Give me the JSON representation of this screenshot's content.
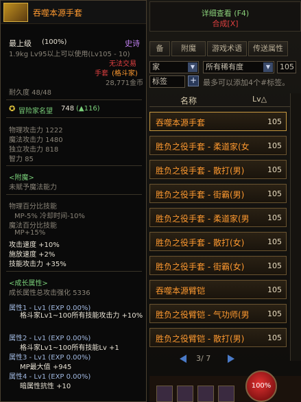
{
  "top_panel": {
    "detail": "详细查看 (F4)",
    "compose": "合成[X]"
  },
  "tabs": [
    "备",
    "附魔",
    "游戏术语",
    "传送属性"
  ],
  "filters": {
    "select1": "家",
    "rarity": "所有稀有度",
    "level": "105",
    "tag_select": "标签",
    "tag_hint": "最多可以添加4个#标签。"
  },
  "list": {
    "header_name": "名称",
    "header_lv": "Lv△",
    "rows": [
      {
        "name": "吞噬本源手套",
        "level": "105"
      },
      {
        "name": "胜负之役手套 - 柔道家(女",
        "level": "105"
      },
      {
        "name": "胜负之役手套 - 散打(男)",
        "level": "105"
      },
      {
        "name": "胜负之役手套 - 街霸(男)",
        "level": "105"
      },
      {
        "name": "胜负之役手套 - 柔道家(男",
        "level": "105"
      },
      {
        "name": "胜负之役手套 - 散打(女)",
        "level": "105"
      },
      {
        "name": "胜负之役手套 - 街霸(女)",
        "level": "105"
      },
      {
        "name": "吞噬本源臂铠",
        "level": "105"
      },
      {
        "name": "胜负之役臂铠 - 气功师(男",
        "level": "105"
      },
      {
        "name": "胜负之役臂铠 - 散打(男)",
        "level": "105"
      }
    ]
  },
  "pager": {
    "page": "3/ 7"
  },
  "orb": {
    "value": "100%"
  },
  "tooltip": {
    "name": "吞噬本源手套",
    "top_level": "最上级",
    "percent": "(100%)",
    "rarity": "史诗",
    "weight_req": "1.9kg  Lv95以上可以使用(Lv105 - 10)",
    "no_trade": "无法交易",
    "type": "手套",
    "class": "(格斗家)",
    "price": "28,771金币",
    "durability": "耐久度 48/48",
    "fame_label": "冒险家名望",
    "fame_value": "748",
    "fame_delta": "(▲116)",
    "stats": [
      "物理攻击力 1222",
      "魔法攻击力 1480",
      "独立攻击力 818",
      "智力 85"
    ],
    "enchant_header": "<附魔>",
    "enchant_value": "未赋予魔法能力",
    "pct_header": "物理百分比技能",
    "pct_line1": "MP-5% 冷却时间-10%",
    "pct_header2": "魔法百分比技能",
    "pct_line2": "MP+15%",
    "speed_lines": [
      "攻击速度 +10%",
      "施放速度 +2%",
      "技能攻击力 +35%"
    ],
    "growth_header": "<成长属性>",
    "growth_total": "成长属性总攻击强化 5336",
    "attributes": [
      {
        "title": "属性1 - Lv1 (EXP 0.00%)",
        "detail": "格斗家Lv1~100所有技能攻击力 +10%"
      },
      {
        "title": "属性2 - Lv1 (EXP 0.00%)",
        "detail": "格斗家Lv1~100所有技能Lv +1"
      },
      {
        "title": "属性3 - Lv1 (EXP 0.00%)",
        "detail": "MP最大值 +945"
      },
      {
        "title": "属性4 - Lv1 (EXP 0.00%)",
        "detail": "暗属性抗性 +10"
      }
    ]
  }
}
